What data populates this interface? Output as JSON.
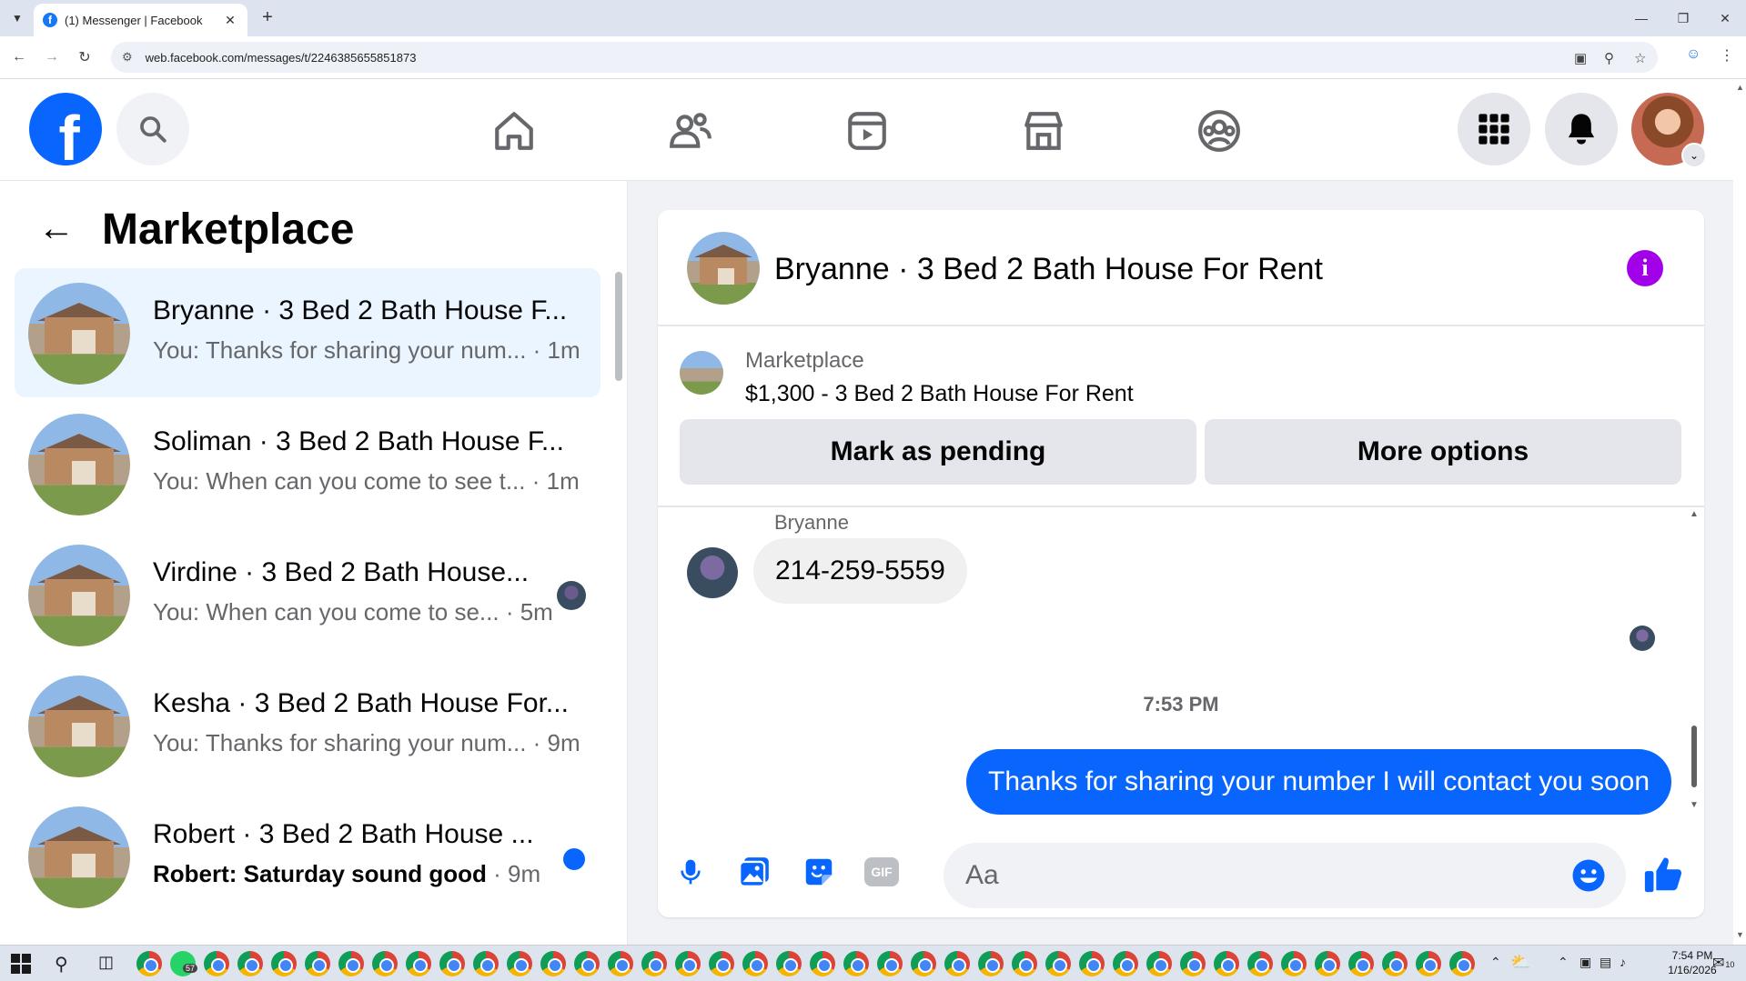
{
  "browser": {
    "tab_title": "(1) Messenger | Facebook",
    "url": "web.facebook.com/messages/t/2246385655851873",
    "favicon_letter": "f"
  },
  "header": {
    "logo_letter": "f"
  },
  "left_panel": {
    "title": "Marketplace",
    "conversations": [
      {
        "name": "Bryanne · 3 Bed 2 Bath House F...",
        "preview": "You: Thanks for sharing your num...",
        "time": " · 1m",
        "active": true,
        "unread": false
      },
      {
        "name": "Soliman · 3 Bed 2 Bath House F...",
        "preview": "You: When can you come to see t...",
        "time": " · 1m",
        "active": false,
        "unread": false
      },
      {
        "name": "Virdine · 3 Bed 2 Bath House...",
        "preview": "You: When can you come to se...",
        "time": " · 5m",
        "active": false,
        "unread": false,
        "seen": true
      },
      {
        "name": "Kesha · 3 Bed 2 Bath House For...",
        "preview": "You: Thanks for sharing your num...",
        "time": " · 9m",
        "active": false,
        "unread": false
      },
      {
        "name": "Robert · 3 Bed 2 Bath House ...",
        "preview": "Robert: Saturday sound good",
        "time": " · 9m",
        "active": false,
        "unread": true
      }
    ]
  },
  "chat": {
    "title": "Bryanne · 3 Bed 2 Bath House For Rent",
    "listing": {
      "source": "Marketplace",
      "title": "$1,300 - 3 Bed 2 Bath House For Rent",
      "mark_pending_label": "Mark as pending",
      "more_options_label": "More options"
    },
    "messages": {
      "sender": "Bryanne",
      "incoming": "214-259-5559",
      "timestamp": "7:53 PM",
      "outgoing": "Thanks for sharing your number I will contact you soon"
    },
    "composer": {
      "placeholder": "Aa",
      "gif_label": "GIF"
    }
  },
  "taskbar": {
    "whatsapp_badge": "57",
    "time": "7:54 PM",
    "date": "1/16/2026",
    "notification_count": "10"
  },
  "colors": {
    "accent": "#0866ff",
    "info": "#a200e8",
    "active_conv": "#ebf5ff"
  }
}
